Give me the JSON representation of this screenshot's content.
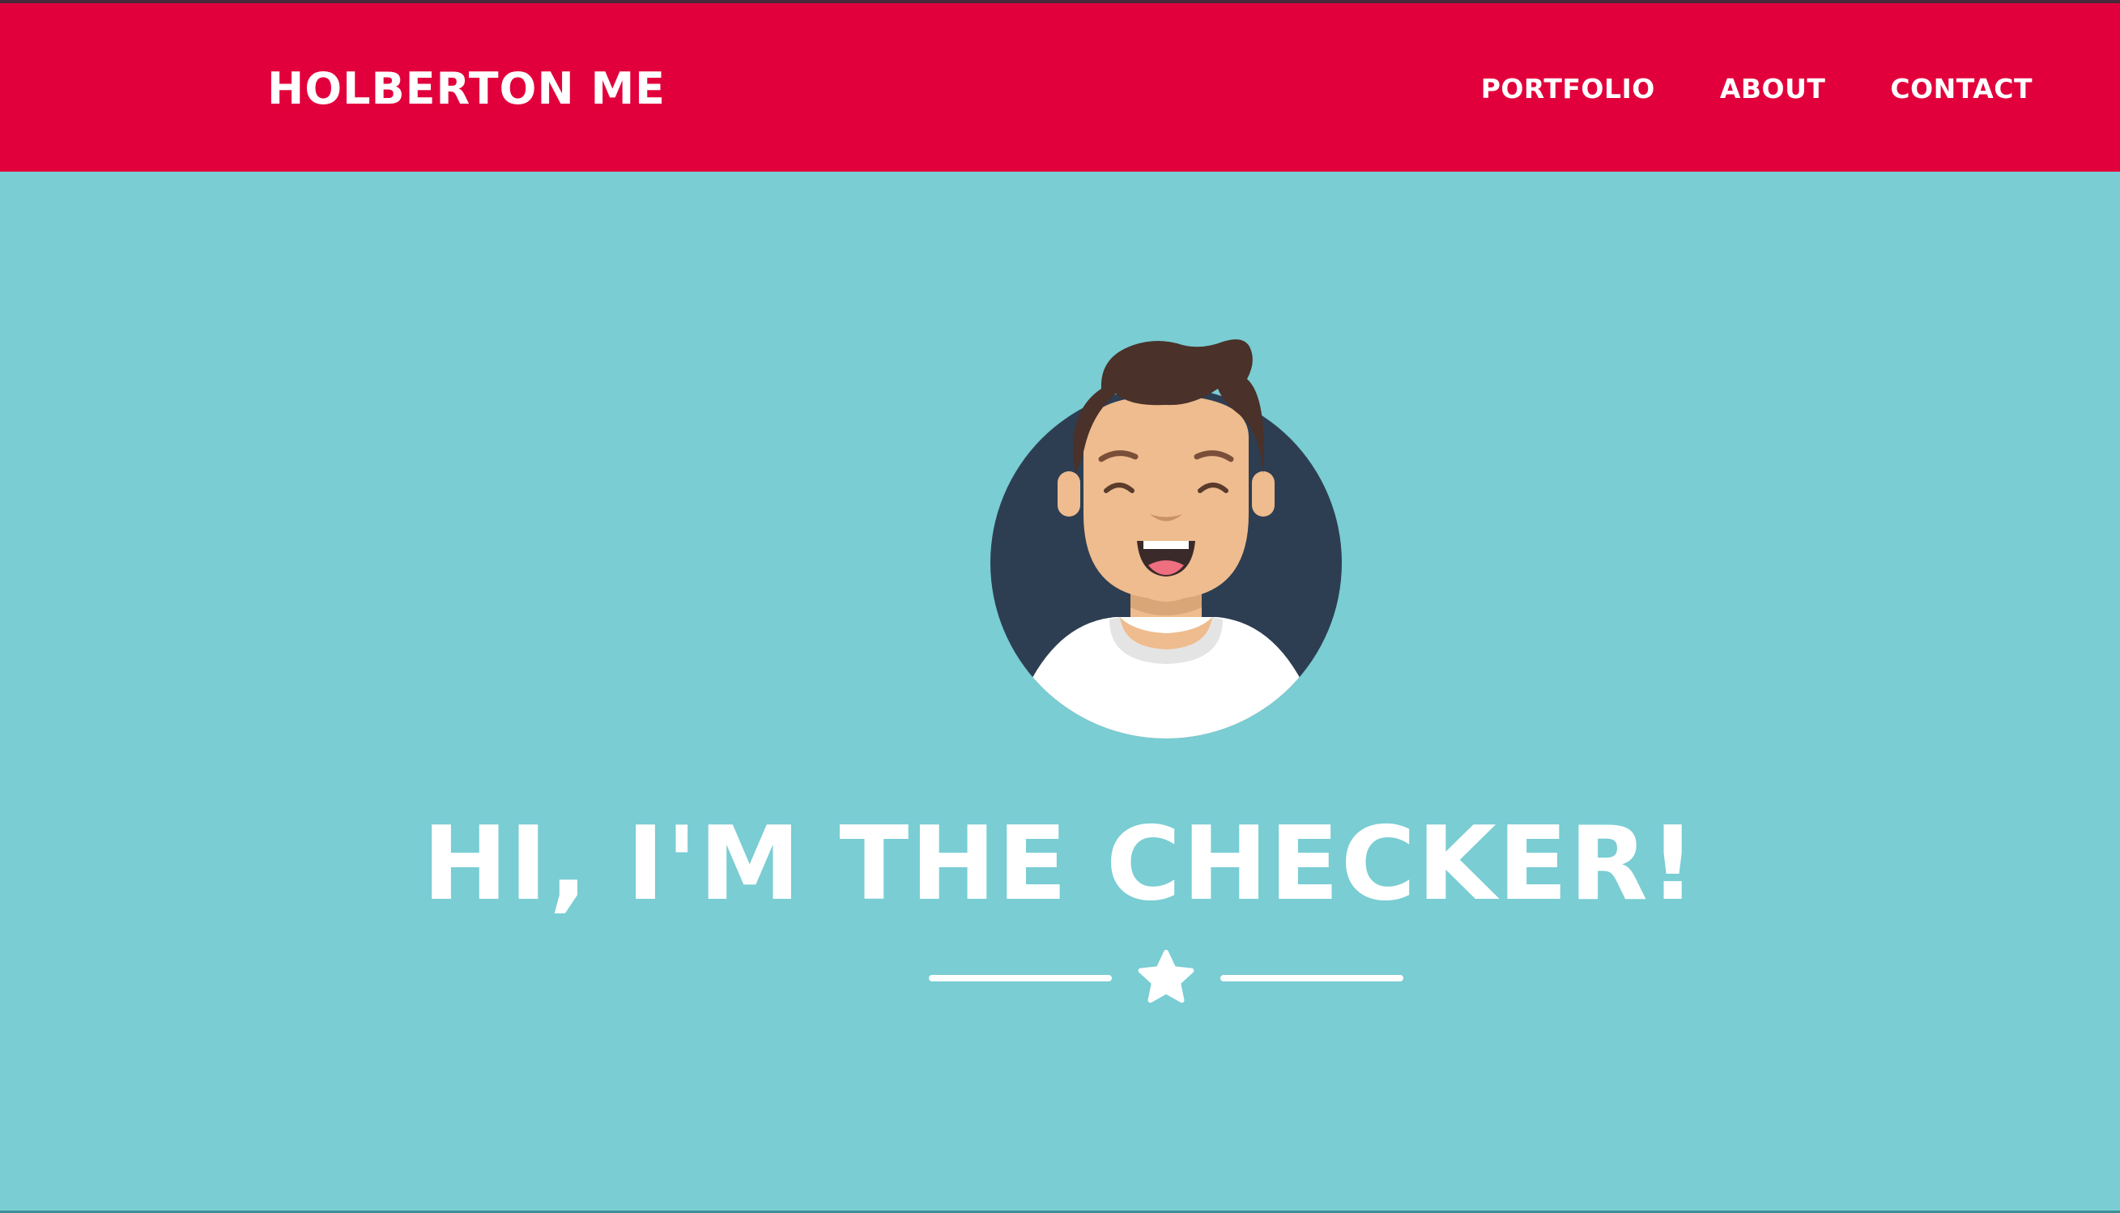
{
  "navbar": {
    "brand": "HOLBERTON ME",
    "links": [
      {
        "label": "PORTFOLIO"
      },
      {
        "label": "ABOUT"
      },
      {
        "label": "CONTACT"
      }
    ]
  },
  "hero": {
    "headline": "HI, I'M THE CHECKER!",
    "avatar_icon": "avatar-illustration",
    "divider_icon": "star-icon"
  },
  "colors": {
    "navbar_bg": "#e2003c",
    "page_bg": "#79cdd3",
    "text": "#ffffff",
    "avatar_circle": "#2e3e52",
    "hair": "#4a3129",
    "skin": "#eebc8e"
  }
}
